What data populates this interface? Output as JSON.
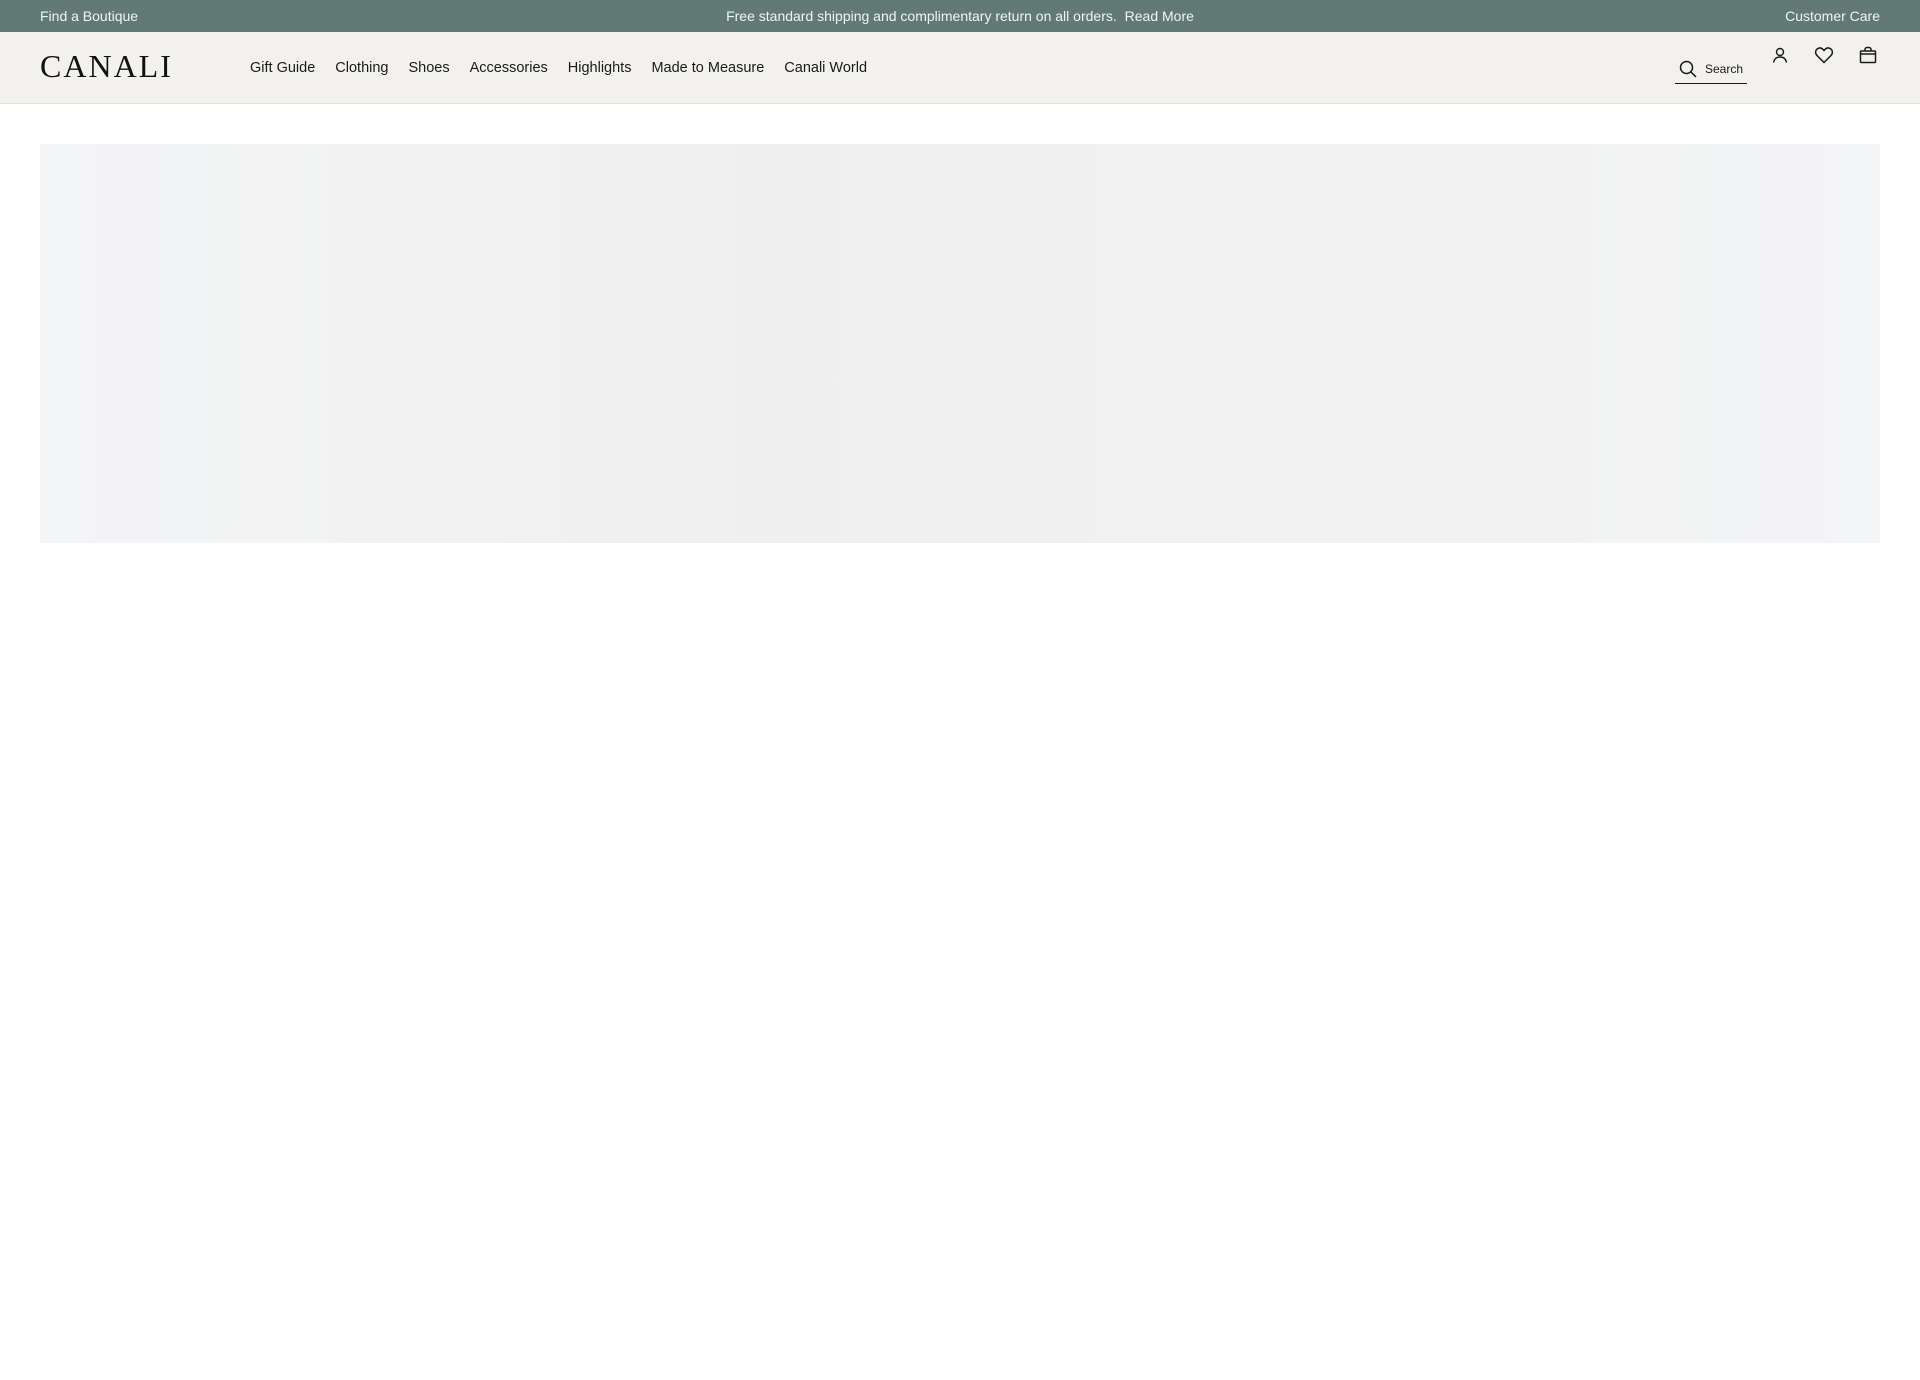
{
  "topbar": {
    "find_boutique": "Find a Boutique",
    "promo": "Free standard shipping and complimentary return on all orders.",
    "read_more": "Read More",
    "customer_care": "Customer Care"
  },
  "header": {
    "logo": "CANALI",
    "nav": [
      {
        "label": "Gift Guide"
      },
      {
        "label": "Clothing"
      },
      {
        "label": "Shoes"
      },
      {
        "label": "Accessories"
      },
      {
        "label": "Highlights"
      },
      {
        "label": "Made to Measure"
      },
      {
        "label": "Canali World"
      }
    ],
    "search_label": "Search",
    "icons": {
      "search": "search-icon",
      "account": "user-icon",
      "wishlist": "heart-icon",
      "bag": "shopping-bag-icon"
    }
  },
  "colors": {
    "topbar_bg": "#617a76",
    "header_bg": "#f2f1ee",
    "placeholder_bg": "#f1f1f1"
  }
}
